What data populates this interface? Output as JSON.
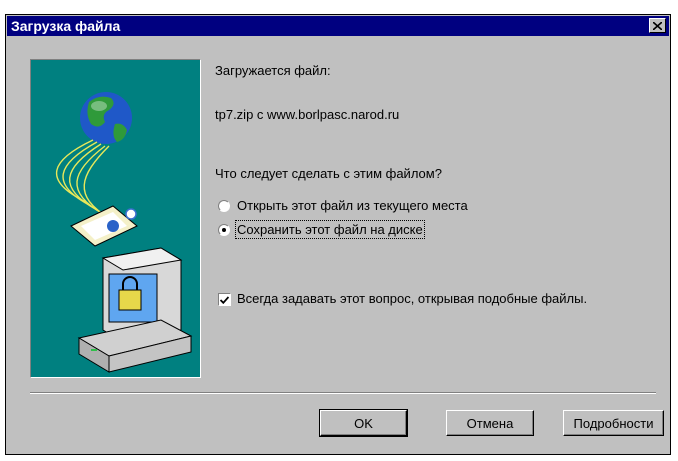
{
  "window": {
    "title": "Загрузка файла"
  },
  "message": {
    "downloading_label": "Загружается файл:",
    "file_source": "tp7.zip с www.borlpasc.narod.ru",
    "question": "Что следует сделать с этим файлом?"
  },
  "options": {
    "open_label": "Открыть этот файл из текущего места",
    "save_label": "Сохранить этот файл на диске",
    "selected": "save"
  },
  "always_ask": {
    "label": "Всегда задавать этот вопрос, открывая подобные файлы.",
    "checked": true
  },
  "buttons": {
    "ok": "OK",
    "cancel": "Отмена",
    "details": "Подробности"
  },
  "colors": {
    "titlebar": "#000080",
    "dialog": "#c0c0c0",
    "illustration_bg": "#008080"
  }
}
